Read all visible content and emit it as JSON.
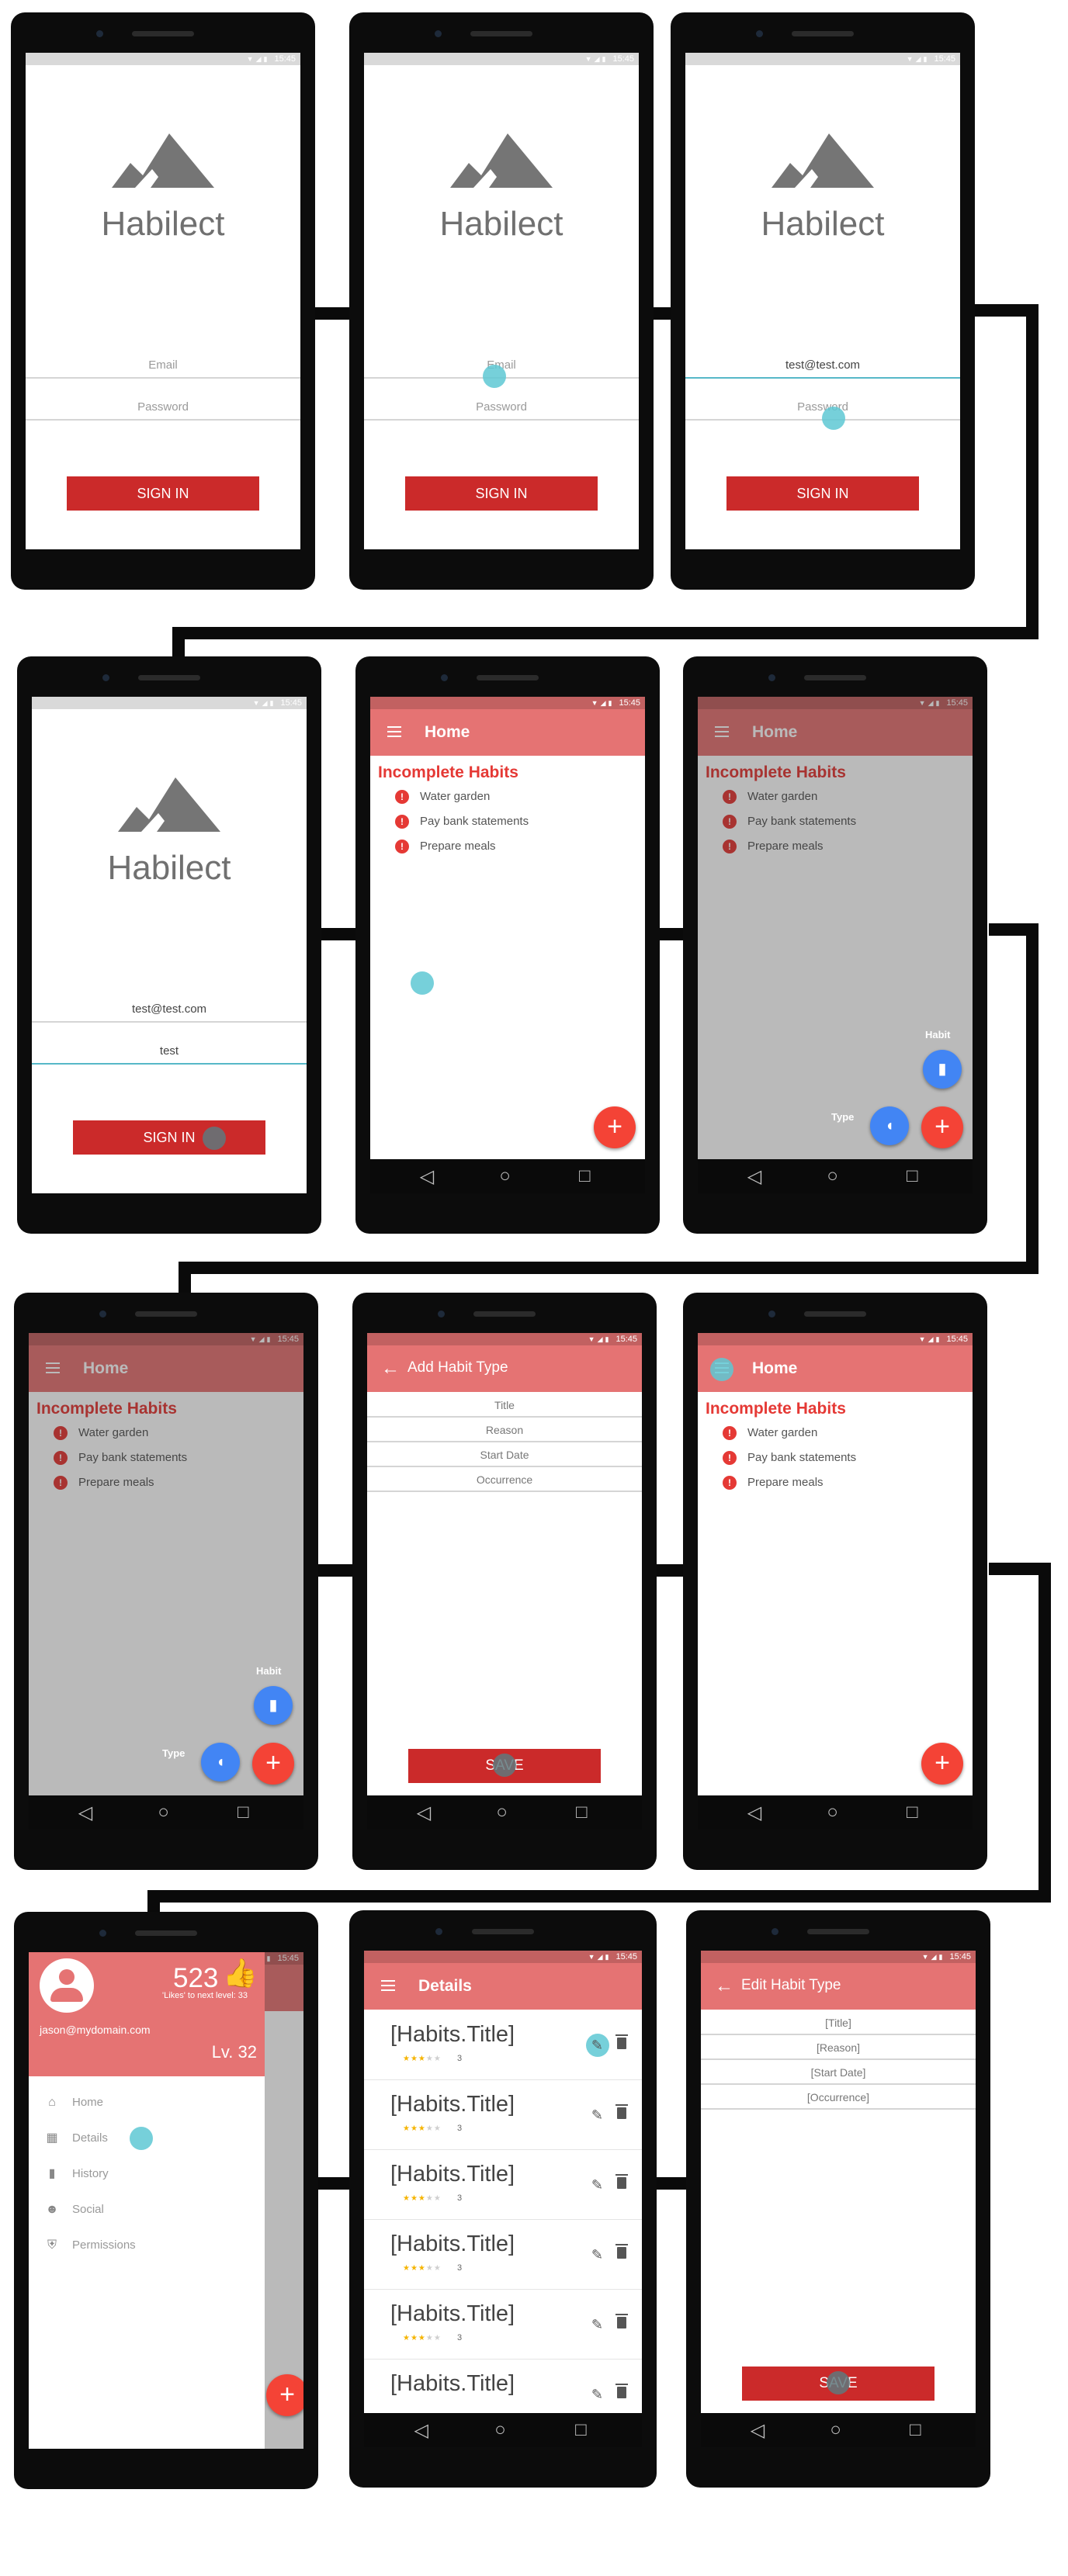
{
  "status_time": "15:45",
  "brand": {
    "primary": "#e57373",
    "accent": "#cb2a2a",
    "fab": "#f44336",
    "mini_fab": "#4285f4"
  },
  "login": {
    "app_name": "Habilect",
    "email_placeholder": "Email",
    "password_placeholder": "Password",
    "email_value": "test@test.com",
    "password_value": "test",
    "signin_label": "SIGN IN"
  },
  "home": {
    "title": "Home",
    "section_title": "Incomplete Habits",
    "habits": [
      {
        "label": "Water garden"
      },
      {
        "label": "Pay bank statements"
      },
      {
        "label": "Prepare meals"
      }
    ],
    "fab_add_icon": "plus-icon",
    "speed_dial": {
      "habit_label": "Habit",
      "type_label": "Type"
    }
  },
  "add_habit_type": {
    "title": "Add Habit Type",
    "fields": [
      "Title",
      "Reason",
      "Start Date",
      "Occurrence"
    ],
    "save_label": "SAVE"
  },
  "drawer": {
    "likes_count": "523",
    "likes_next": "'Likes' to next level: 33",
    "email": "jason@mydomain.com",
    "level": "Lv. 32",
    "items": [
      {
        "label": "Home",
        "icon": "home-icon"
      },
      {
        "label": "Details",
        "icon": "chart-icon"
      },
      {
        "label": "History",
        "icon": "book-icon"
      },
      {
        "label": "Social",
        "icon": "people-icon"
      },
      {
        "label": "Permissions",
        "icon": "shield-icon"
      }
    ]
  },
  "details": {
    "title": "Details",
    "item_title": "[Habits.Title]",
    "rating": "3"
  },
  "edit_habit_type": {
    "title": "Edit Habit Type",
    "fields": [
      "[Title]",
      "[Reason]",
      "[Start Date]",
      "[Occurrence]"
    ],
    "save_label": "SAVE"
  }
}
